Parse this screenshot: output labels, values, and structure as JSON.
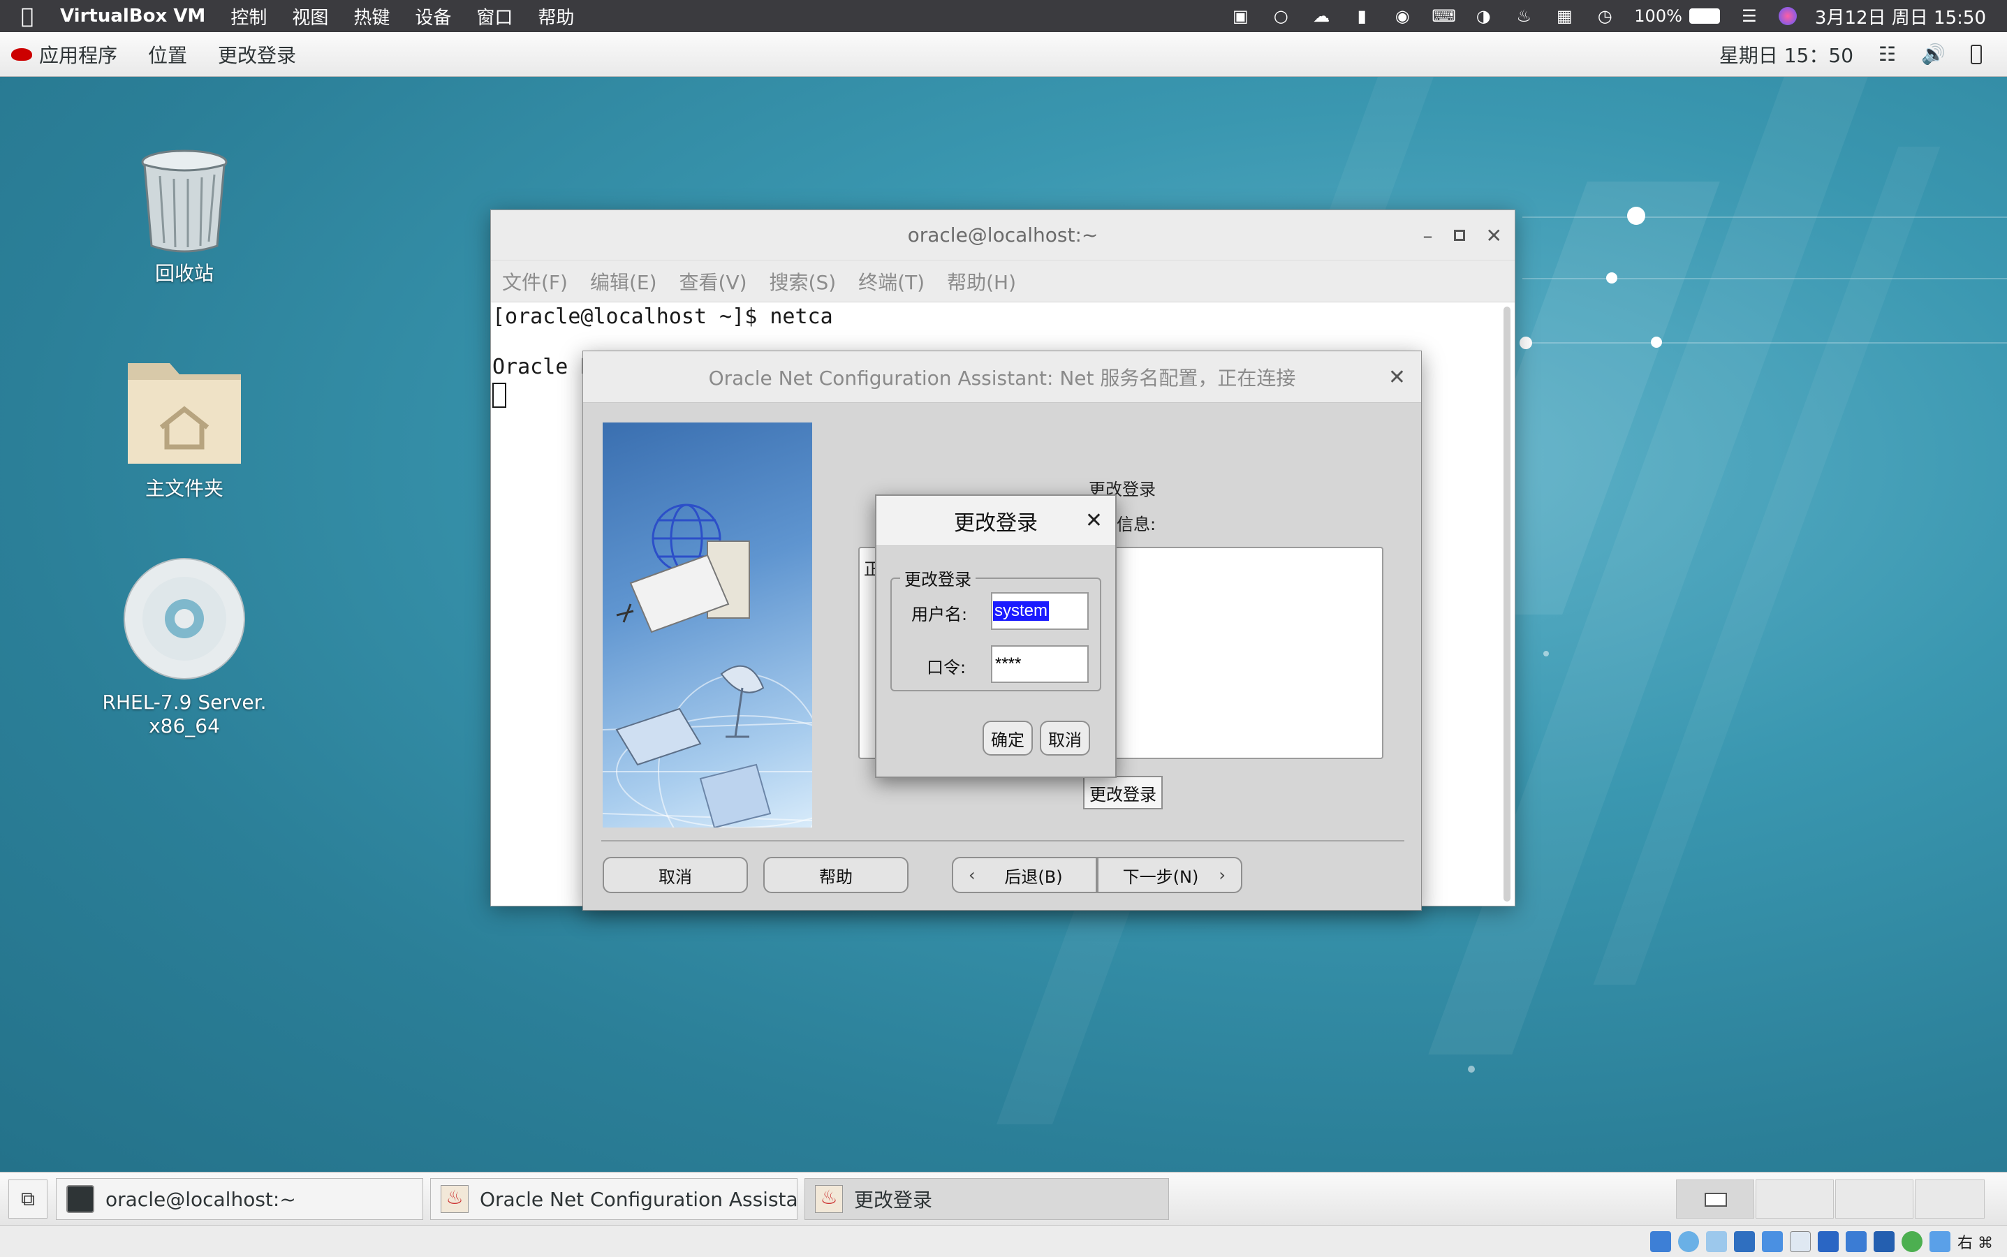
{
  "mac_menubar": {
    "app_name": "VirtualBox VM",
    "menus": [
      "控制",
      "视图",
      "热键",
      "设备",
      "窗口",
      "帮助"
    ],
    "battery": "100%",
    "datetime": "3月12日 周日 15:50"
  },
  "gnome_bar": {
    "applications": "应用程序",
    "places": "位置",
    "active_window": "更改登录",
    "clock": "星期日 15：50"
  },
  "desktop": {
    "icons": [
      {
        "label": "回收站"
      },
      {
        "label": "主文件夹"
      },
      {
        "label_line1": "RHEL-7.9 Server.",
        "label_line2": "x86_64"
      }
    ]
  },
  "terminal": {
    "title": "oracle@localhost:~",
    "menu": [
      "文件(F)",
      "编辑(E)",
      "查看(V)",
      "搜索(S)",
      "终端(T)",
      "帮助(H)"
    ],
    "lines": [
      "[oracle@localhost ~]$ netca",
      "Oracle N"
    ]
  },
  "netca": {
    "title": "Oracle Net Configuration Assistant: Net 服务名配置，正在连接",
    "heading": "更改登录",
    "info_label": "信息:",
    "info_peek": "正",
    "change_login_button": "更改登录",
    "cancel": "取消",
    "help": "帮助",
    "back": "后退(B)",
    "next": "下一步(N)"
  },
  "login_dialog": {
    "title": "更改登录",
    "group_label": "更改登录",
    "username_label": "用户名:",
    "username_value": "system",
    "password_label": "口令:",
    "password_value": "****",
    "ok": "确定",
    "cancel": "取消"
  },
  "taskbar": {
    "tasks": [
      {
        "label": "oracle@localhost:~"
      },
      {
        "label": "Oracle Net Configuration Assistant: ···"
      },
      {
        "label": "更改登录"
      }
    ]
  },
  "colors": {
    "desktop_teal": "#3a97b0",
    "selection_blue": "#1a1aff",
    "mac_bar": "#3b3b3f"
  }
}
